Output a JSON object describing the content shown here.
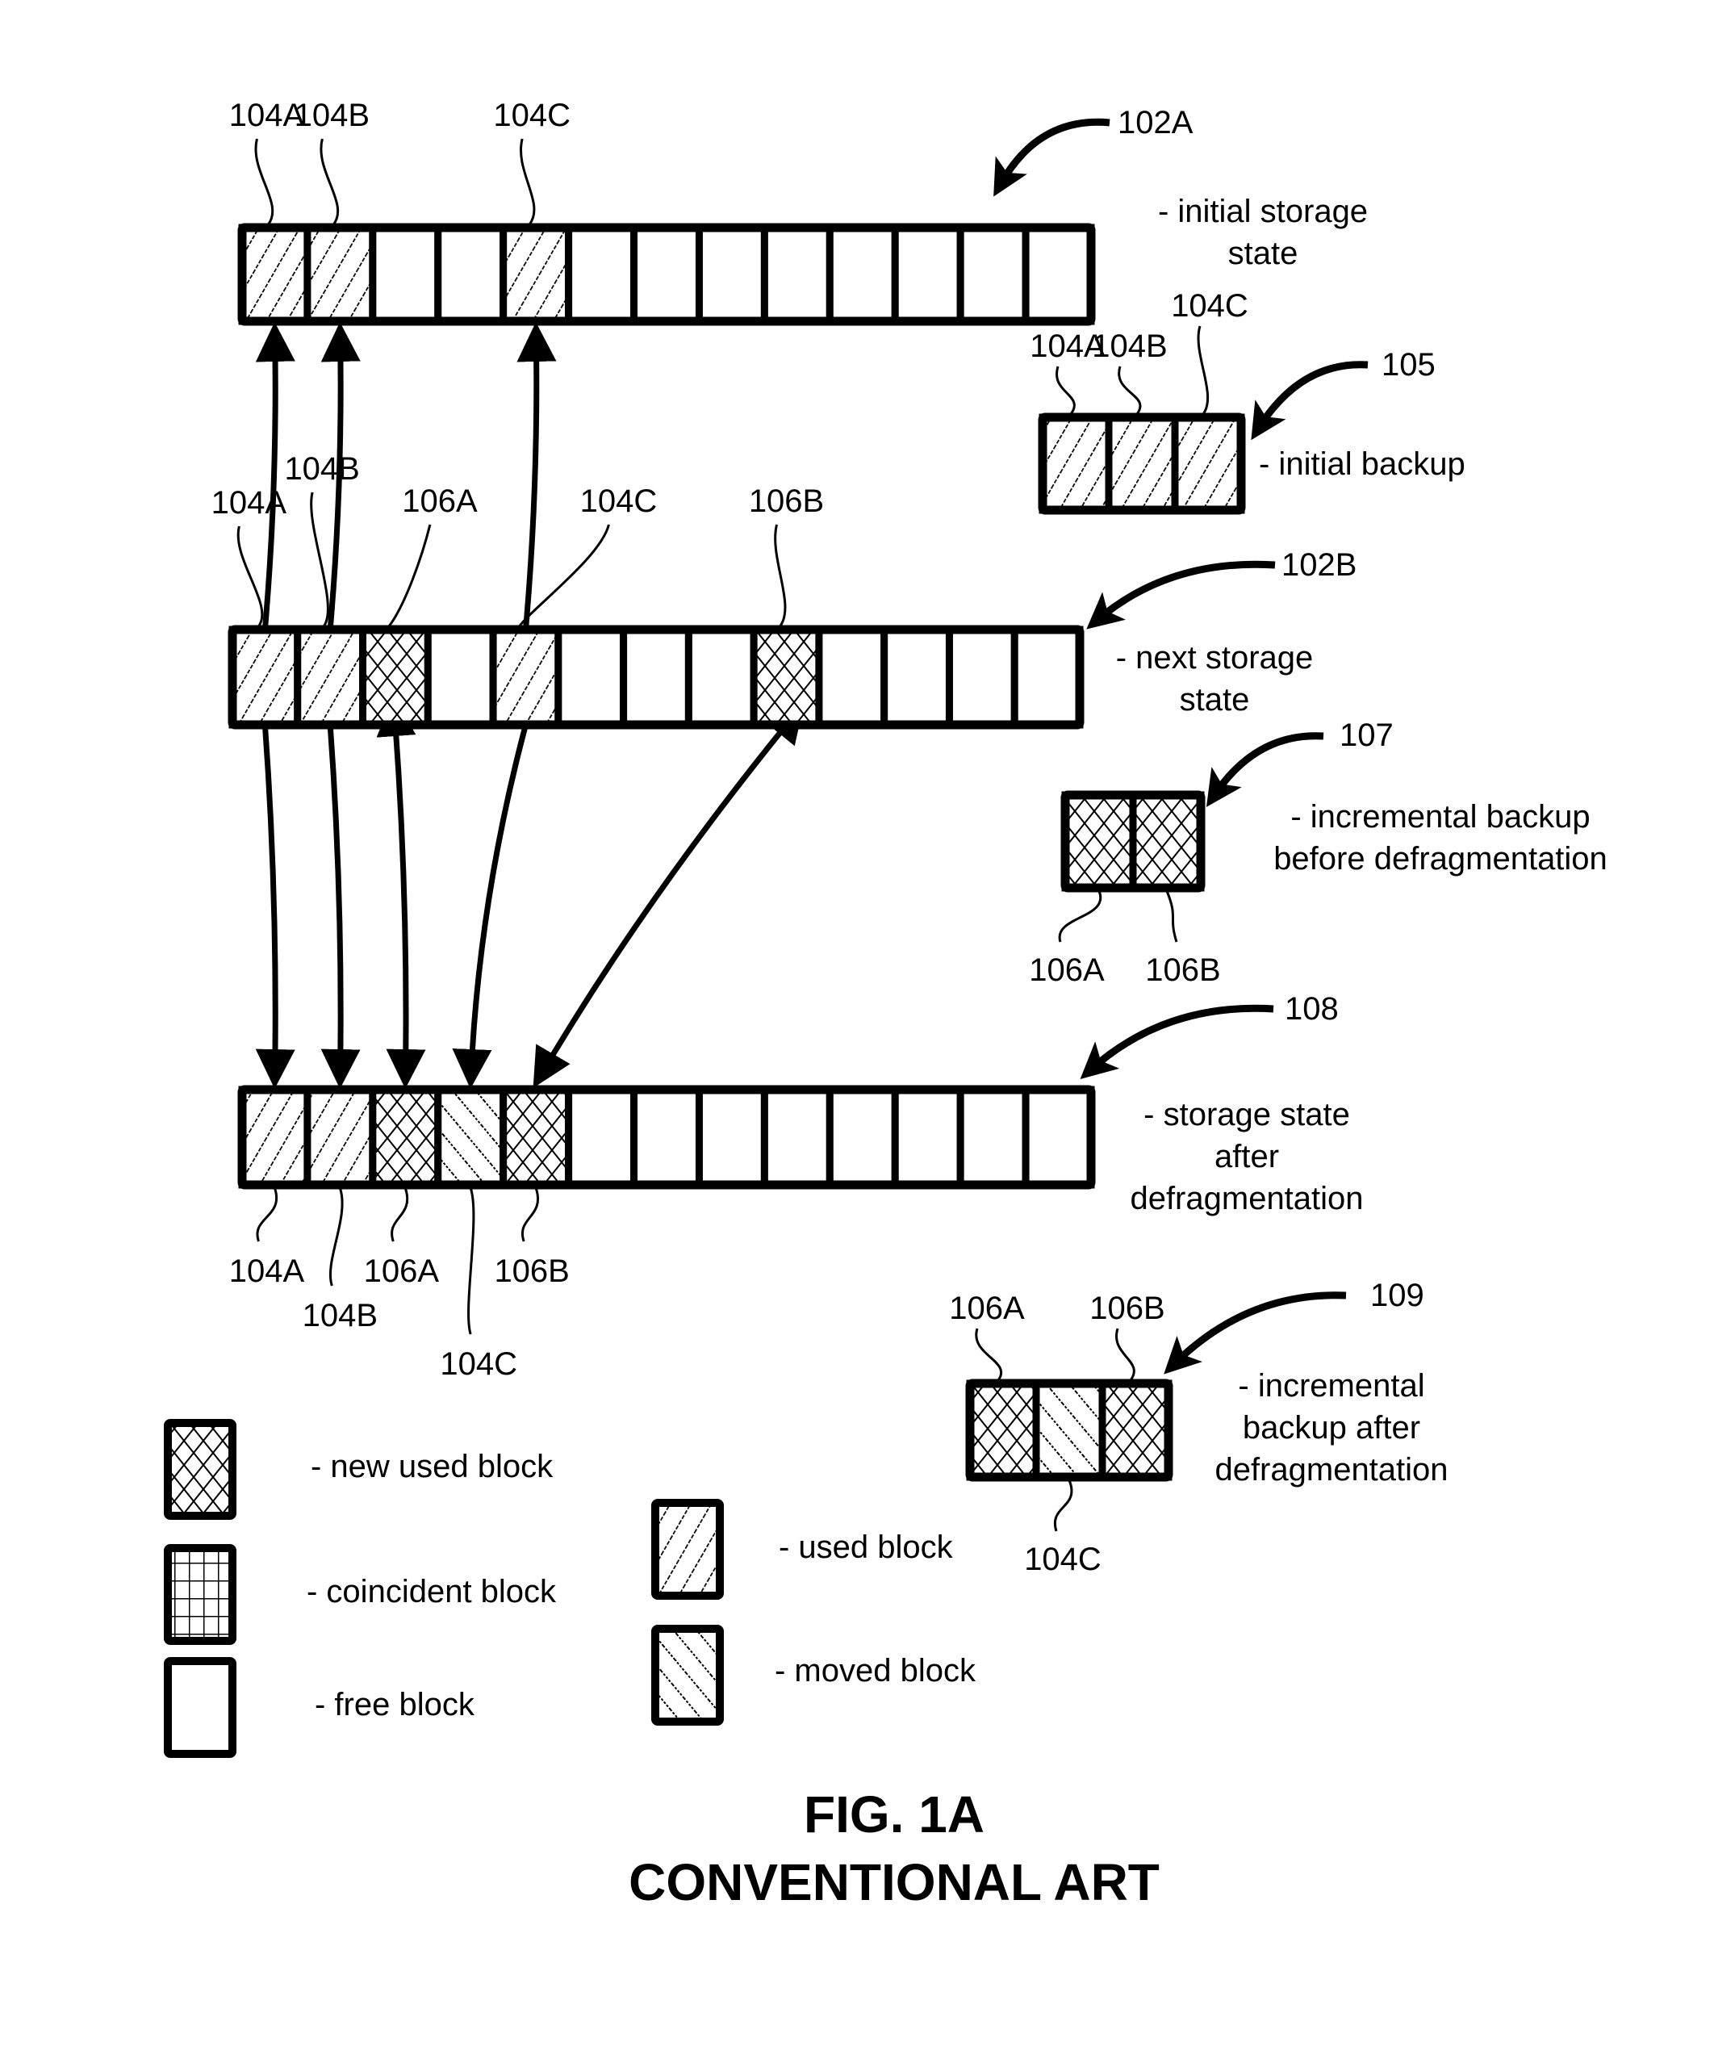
{
  "figure": {
    "title": "FIG. 1A",
    "subtitle": "CONVENTIONAL ART"
  },
  "block_types": {
    "used": "used block",
    "new": "new used block",
    "moved": "moved block",
    "coincident": "coincident block",
    "free": "free block"
  },
  "storage_rows": [
    {
      "id": "102A",
      "ref": "102A",
      "description": [
        "- initial storage",
        "state"
      ],
      "cells": [
        "used",
        "used",
        "free",
        "free",
        "used",
        "free",
        "free",
        "free",
        "free",
        "free",
        "free",
        "free",
        "free"
      ],
      "labels": [
        {
          "cell": 0,
          "text": "104A",
          "side": "top"
        },
        {
          "cell": 1,
          "text": "104B",
          "side": "top"
        },
        {
          "cell": 4,
          "text": "104C",
          "side": "top"
        }
      ]
    },
    {
      "id": "102B",
      "ref": "102B",
      "description": [
        "- next storage",
        "state"
      ],
      "cells": [
        "used",
        "used",
        "new",
        "free",
        "used",
        "free",
        "free",
        "free",
        "new",
        "free",
        "free",
        "free",
        "free"
      ],
      "labels": [
        {
          "cell": 0,
          "text": "104A",
          "side": "top"
        },
        {
          "cell": 1,
          "text": "104B",
          "side": "top"
        },
        {
          "cell": 2,
          "text": "106A",
          "side": "top"
        },
        {
          "cell": 4,
          "text": "104C",
          "side": "top"
        },
        {
          "cell": 8,
          "text": "106B",
          "side": "top"
        }
      ]
    },
    {
      "id": "108",
      "ref": "108",
      "description": [
        "- storage state",
        "after",
        "defragmentation"
      ],
      "cells": [
        "used",
        "used",
        "new",
        "moved",
        "new",
        "free",
        "free",
        "free",
        "free",
        "free",
        "free",
        "free",
        "free"
      ],
      "labels": [
        {
          "cell": 0,
          "text": "104A",
          "side": "bottom"
        },
        {
          "cell": 1,
          "text": "104B",
          "side": "bottom"
        },
        {
          "cell": 2,
          "text": "106A",
          "side": "bottom"
        },
        {
          "cell": 3,
          "text": "104C",
          "side": "bottom"
        },
        {
          "cell": 4,
          "text": "106B",
          "side": "bottom"
        }
      ]
    }
  ],
  "backups": [
    {
      "id": "105",
      "ref": "105",
      "description": [
        "- initial backup"
      ],
      "cells": [
        "used",
        "used",
        "used"
      ],
      "labels": [
        "104A",
        "104B",
        "104C"
      ]
    },
    {
      "id": "107",
      "ref": "107",
      "description": [
        "- incremental backup",
        "before defragmentation"
      ],
      "cells": [
        "new",
        "new"
      ],
      "labels": [
        "106A",
        "106B"
      ]
    },
    {
      "id": "109",
      "ref": "109",
      "description": [
        "- incremental",
        "backup after",
        "defragmentation"
      ],
      "cells": [
        "new",
        "moved",
        "new"
      ],
      "labels": [
        "106A",
        "104C",
        "106B"
      ]
    }
  ],
  "mappings": [
    {
      "from_row": "102B",
      "from_cell": 0,
      "to_row": "102A",
      "to_cell": 0
    },
    {
      "from_row": "102B",
      "from_cell": 1,
      "to_row": "102A",
      "to_cell": 1
    },
    {
      "from_row": "102B",
      "from_cell": 4,
      "to_row": "102A",
      "to_cell": 4
    },
    {
      "from_row": "102B",
      "from_cell": 0,
      "to_row": "108",
      "to_cell": 0
    },
    {
      "from_row": "102B",
      "from_cell": 1,
      "to_row": "108",
      "to_cell": 1
    },
    {
      "from_row": "102B",
      "from_cell": 2,
      "to_row": "108",
      "to_cell": 2,
      "bidirectional": true
    },
    {
      "from_row": "102B",
      "from_cell": 4,
      "to_row": "108",
      "to_cell": 3
    },
    {
      "from_row": "102B",
      "from_cell": 8,
      "to_row": "108",
      "to_cell": 4,
      "bidirectional": true
    }
  ],
  "legend": [
    {
      "type": "new",
      "label": "- new used block"
    },
    {
      "type": "coincident",
      "label": "- coincident block"
    },
    {
      "type": "free",
      "label": "- free block"
    },
    {
      "type": "used",
      "label": "- used block"
    },
    {
      "type": "moved",
      "label": "- moved block"
    }
  ]
}
